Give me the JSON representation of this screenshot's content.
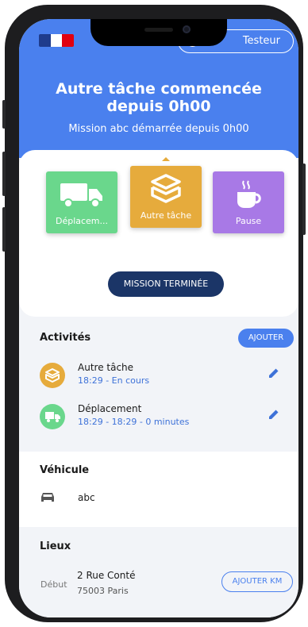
{
  "header": {
    "user_button_label": "Testeur",
    "title": "Autre tâche commencée depuis 0h00",
    "subtitle": "Mission abc démarrée depuis 0h00"
  },
  "activity_tiles": [
    {
      "label": "Déplacem...",
      "color": "#6ad78c",
      "icon": "truck-icon"
    },
    {
      "label": "Autre tâche",
      "color": "#e6ab3c",
      "icon": "box-icon",
      "selected": true
    },
    {
      "label": "Pause",
      "color": "#a879e6",
      "icon": "coffee-icon"
    }
  ],
  "end_mission_label": "MISSION TERMINÉE",
  "activities": {
    "title": "Activités",
    "add_label": "AJOUTER",
    "items": [
      {
        "name": "Autre tâche",
        "time": "18:29 - En cours",
        "color": "#e6ab3c",
        "icon": "box-icon"
      },
      {
        "name": "Déplacement",
        "time": "18:29 - 18:29 - 0 minutes",
        "color": "#6ad78c",
        "icon": "truck-icon"
      }
    ]
  },
  "vehicle": {
    "title": "Véhicule",
    "name": "abc",
    "icon": "car-icon"
  },
  "places": {
    "title": "Lieux",
    "start_label": "Début",
    "address_line1": "2 Rue Conté",
    "address_line2": "75003 Paris",
    "add_km_label": "AJOUTER KM"
  },
  "colors": {
    "primary": "#4a80ee",
    "dark_button": "#1b3567"
  }
}
